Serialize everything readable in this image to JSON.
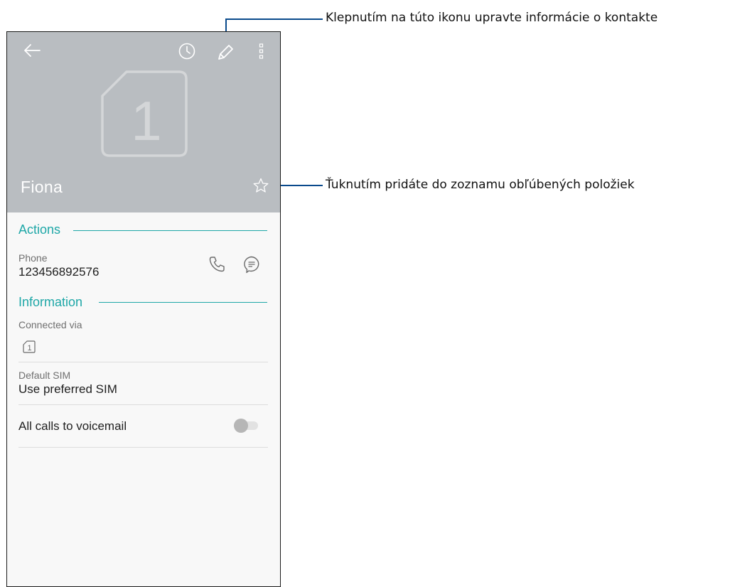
{
  "callouts": {
    "edit": "Klepnutím na túto ikonu upravte informácie o kontakte",
    "favorite": "Ťuknutím pridáte do zoznamu obľúbených položiek"
  },
  "header": {
    "icons": [
      "back-arrow-icon",
      "history-icon",
      "edit-pencil-icon",
      "more-vertical-icon"
    ],
    "sim_number": "1",
    "contact_name": "Fiona",
    "favorite_icon": "star-outline-icon",
    "background_color": "#b9bdc1"
  },
  "actions": {
    "title": "Actions",
    "phone_label": "Phone",
    "phone_number": "123456892576",
    "icons": [
      "phone-icon",
      "message-icon"
    ]
  },
  "information": {
    "title": "Information",
    "connected_via_label": "Connected via",
    "connected_sim": "1",
    "default_sim_label": "Default SIM",
    "default_sim_value": "Use preferred SIM"
  },
  "voicemail": {
    "label": "All calls to voicemail",
    "enabled": false
  },
  "colors": {
    "accent": "#1ea7a7",
    "callout": "#0a4a8c"
  }
}
